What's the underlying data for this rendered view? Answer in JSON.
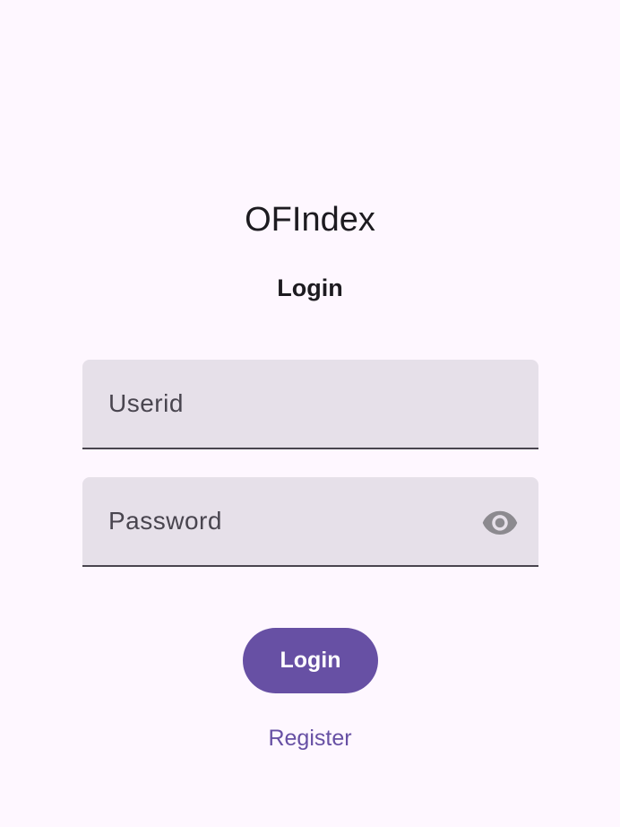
{
  "app": {
    "title": "OFIndex"
  },
  "screen": {
    "title": "Login"
  },
  "form": {
    "userid": {
      "value": "",
      "placeholder": "Userid"
    },
    "password": {
      "value": "",
      "placeholder": "Password",
      "toggle_icon": "eye-icon"
    },
    "login_label": "Login",
    "register_label": "Register"
  },
  "colors": {
    "background": "#fef7ff",
    "field_background": "#e6e0e9",
    "primary": "#6750a4",
    "text": "#1d1b20",
    "placeholder": "#49454f",
    "icon": "#8c8a8f"
  }
}
